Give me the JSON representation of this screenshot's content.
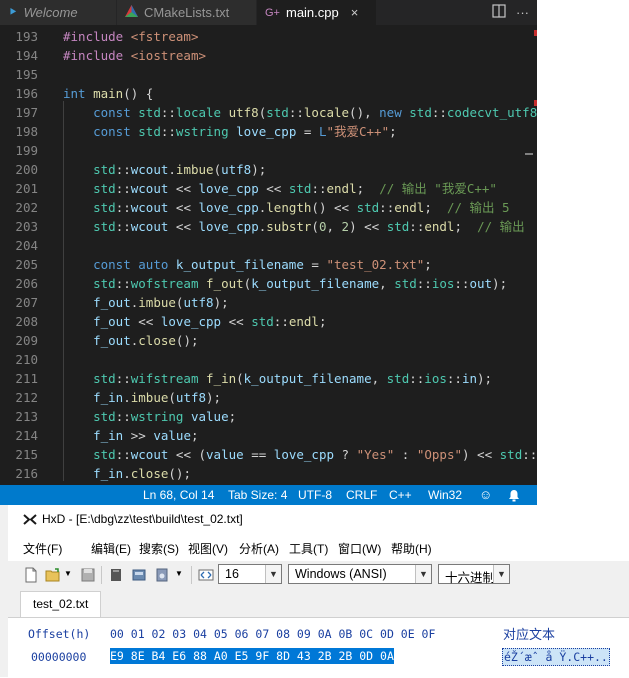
{
  "vscode": {
    "tabs": [
      {
        "label": "Welcome",
        "icon": "vscode-icon",
        "active": false
      },
      {
        "label": "CMakeLists.txt",
        "icon": "cmake-icon",
        "active": false
      },
      {
        "label": "main.cpp",
        "icon": "cpp-icon",
        "active": true,
        "close": "×"
      }
    ],
    "actions": {
      "split": "⊟",
      "more": "···"
    },
    "lines": [
      {
        "n": "193"
      },
      {
        "n": "194"
      },
      {
        "n": "195"
      },
      {
        "n": "196"
      },
      {
        "n": "197"
      },
      {
        "n": "198"
      },
      {
        "n": "199"
      },
      {
        "n": "200"
      },
      {
        "n": "201"
      },
      {
        "n": "202"
      },
      {
        "n": "203"
      },
      {
        "n": "204"
      },
      {
        "n": "205"
      },
      {
        "n": "206"
      },
      {
        "n": "207"
      },
      {
        "n": "208"
      },
      {
        "n": "209"
      },
      {
        "n": "210"
      },
      {
        "n": "211"
      },
      {
        "n": "212"
      },
      {
        "n": "213"
      },
      {
        "n": "214"
      },
      {
        "n": "215"
      },
      {
        "n": "216"
      }
    ],
    "status": {
      "position": "Ln 68, Col 14",
      "tab_size": "Tab Size: 4",
      "encoding": "UTF-8",
      "eol": "CRLF",
      "language": "C++",
      "platform": "Win32",
      "feedback_icon": "☺",
      "bell_icon": "🔔"
    }
  },
  "hxd": {
    "title": "HxD - [E:\\dbg\\zz\\test\\build\\test_02.txt]",
    "menu": [
      "文件(F)",
      "编辑(E)",
      "搜索(S)",
      "视图(V)",
      "分析(A)",
      "工具(T)",
      "窗口(W)",
      "帮助(H)"
    ],
    "toolbar": {
      "bytes_per_row": "16",
      "charset": "Windows (ANSI)",
      "display_mode": "十六进制"
    },
    "file_tab": "test_02.txt",
    "header": {
      "offset": "Offset(h)",
      "cols": "00 01 02 03 04 05 06 07 08 09 0A 0B 0C 0D 0E 0F",
      "text": "对应文本"
    },
    "row": {
      "offset": "00000000",
      "bytes": "E9 8E B4 E6 88 A0 E5 9F 8D 43 2B 2B 0D 0A",
      "text": "éŽ´æˆ å Ÿ.C++.."
    }
  }
}
